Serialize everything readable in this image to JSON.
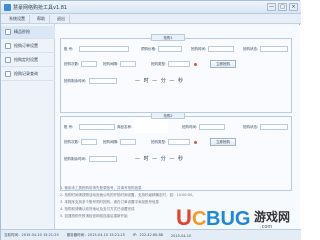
{
  "window": {
    "title": "慧豪网络购抢工具v1.81",
    "controls": [
      "—",
      "□",
      "×"
    ]
  },
  "menu": [
    {
      "label": "系统设置"
    },
    {
      "label": "帮助"
    },
    {
      "label": "退出"
    }
  ],
  "sidebar": {
    "items": [
      {
        "label": "精品秒抢"
      },
      {
        "label": "抢购订单设置"
      },
      {
        "label": "抢购定时设置"
      },
      {
        "label": "抢购记录查询"
      }
    ]
  },
  "panels": [
    {
      "title": "抢购1",
      "account_label": "账  号:",
      "price_label": "预购价格:",
      "time_label": "抢购时间:",
      "status_label": "抢购状态:",
      "product_label": "商品名称:",
      "count_label": "抢购次数:",
      "interval_label": "抢购间隔:",
      "type_label": "抢购类型:",
      "start_button": "立即抢购",
      "remaining_label": "抢购剩余时间:",
      "timer_text": "— 时 — 分 — 秒"
    },
    {
      "title": "抢购2",
      "account_label": "账  号:",
      "price_label": "预购价格:",
      "time_label": "抢购时间:",
      "status_label": "抢购状态:",
      "product_label": "商品名称:",
      "count_label": "抢购次数:",
      "interval_label": "抢购间隔:",
      "type_label": "抢购类型:",
      "start_button": "立即抢购",
      "remaining_label": "抢购剩余时间:",
      "timer_text": "— 时 — 分 — 秒"
    }
  ],
  "instructions": [
    "1. 使用本工具抢购前请先登录账号，并填写抢购信息",
    "2. 抢购时间请按照活动页面公布的开抢时间设置，支持秒级精确定时，如：10:00:00。",
    "3. 本程序支持多个账号同时抢购，请在订单设置中添加账号信息",
    "4. 抢购前请确认收货地址及支付方式已设置完成",
    "5. 如遇抢购失败请检查网络连接后重新开始"
  ],
  "statusbar": {
    "segments": [
      "当前时间：2015-04-10 15:21:25",
      "服务器时间：2015-04-10 15:21:25",
      "IP：222.42.60.88",
      "2015-04-10"
    ]
  },
  "watermark": {
    "brand_u": "U",
    "brand_c": "C",
    "brand_bug": "BUG",
    "brand_cn": "游戏网",
    "domain": ".com"
  },
  "colors": {
    "accent": "#3d8bd9",
    "border": "#b8cbe0",
    "status_dot": "#d9534f"
  }
}
